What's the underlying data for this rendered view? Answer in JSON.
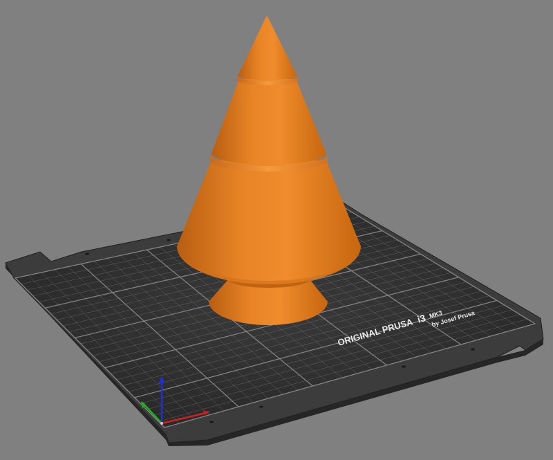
{
  "viewport": {
    "background": "#808080",
    "model_color": "#e07a1f"
  },
  "bed": {
    "brand": "ORIGINAL PRUSA",
    "model": "i3",
    "variant": "MK3",
    "maker": "by Josef Prusa",
    "surface_color": "#2a2a2a",
    "frame_color": "#3c3c3c",
    "grid_color": "#8a8a8a"
  },
  "axes": {
    "x_color": "#d02020",
    "y_color": "#20b020",
    "z_color": "#2030d0"
  },
  "model": {
    "name": "christmas-tree",
    "tiers": 4
  }
}
